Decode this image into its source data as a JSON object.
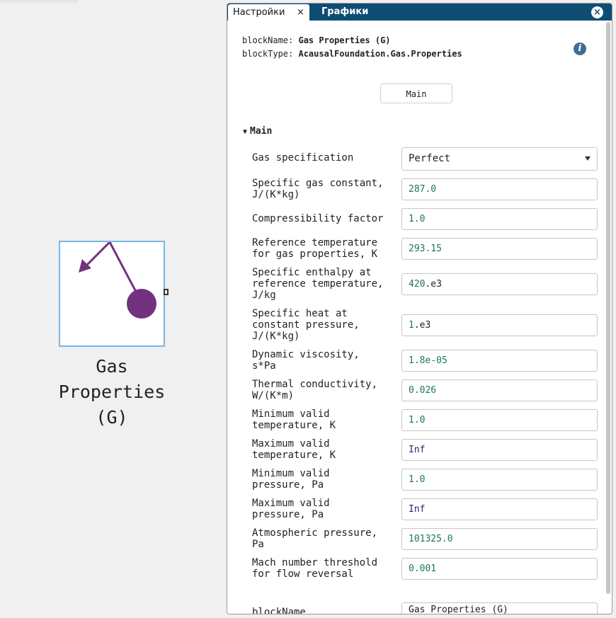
{
  "canvas_block": {
    "label_lines": [
      "Gas",
      "Properties",
      "(G)"
    ]
  },
  "panel": {
    "tabs": [
      {
        "label": "Настройки",
        "active": true
      },
      {
        "label": "Графики",
        "active": false
      }
    ],
    "tab_close_glyph": "×",
    "panel_close_glyph": "×",
    "meta": {
      "block_name_key": "blockName:",
      "block_name_value": "Gas Properties (G)",
      "block_type_key": "blockType:",
      "block_type_value": "AcausalFoundation.Gas.Properties"
    },
    "info_glyph": "i",
    "group_button": "Main",
    "section": {
      "caret": "▼",
      "title": "Main"
    },
    "gas_spec": {
      "label": "Gas specification",
      "value": "Perfect"
    },
    "params": [
      {
        "label": [
          "Specific gas constant,",
          "J/(K*kg)"
        ],
        "value_num": "287.0",
        "value_rest": ""
      },
      {
        "label": [
          "Compressibility factor"
        ],
        "value_num": "1.0",
        "value_rest": ""
      },
      {
        "label": [
          "Reference temperature",
          "for gas properties, K"
        ],
        "value_num": "293.15",
        "value_rest": ""
      },
      {
        "label": [
          "Specific enthalpy at",
          "reference temperature,",
          "J/kg"
        ],
        "value_num": "420",
        "value_rest": ".e3"
      },
      {
        "label": [
          "Specific heat at",
          "constant pressure,",
          "J/(K*kg)"
        ],
        "value_num": "1",
        "value_rest": ".e3"
      },
      {
        "label": [
          "Dynamic viscosity,",
          "s*Pa"
        ],
        "value_num": "1.8e-05",
        "value_rest": ""
      },
      {
        "label": [
          "Thermal conductivity,",
          "W/(K*m)"
        ],
        "value_num": "0.026",
        "value_rest": ""
      },
      {
        "label": [
          "Minimum valid",
          "temperature, K"
        ],
        "value_num": "1.0",
        "value_rest": ""
      },
      {
        "label": [
          "Maximum valid",
          "temperature, K"
        ],
        "value_inf": "Inf"
      },
      {
        "label": [
          "Minimum valid",
          "pressure, Pa"
        ],
        "value_num": "1.0",
        "value_rest": ""
      },
      {
        "label": [
          "Maximum valid",
          "pressure, Pa"
        ],
        "value_inf": "Inf"
      },
      {
        "label": [
          "Atmospheric pressure,",
          "Pa"
        ],
        "value_num": "101325.0",
        "value_rest": ""
      },
      {
        "label": [
          "Mach number threshold",
          "for flow reversal"
        ],
        "value_num": "0.001",
        "value_rest": ""
      }
    ],
    "block_name_field": {
      "label": "blockName",
      "value": "Gas Properties (G)"
    }
  },
  "colors": {
    "tab_bar": "#0f4c73",
    "block_border": "#78b6e4",
    "pendulum": "#74317f",
    "numeric_value": "#1b7a4a",
    "inf_value": "#1e2c6e"
  },
  "icons": {
    "block_icon": "pendulum-icon",
    "info": "info-icon",
    "dropdown": "chevron-down-icon",
    "close": "close-icon"
  }
}
